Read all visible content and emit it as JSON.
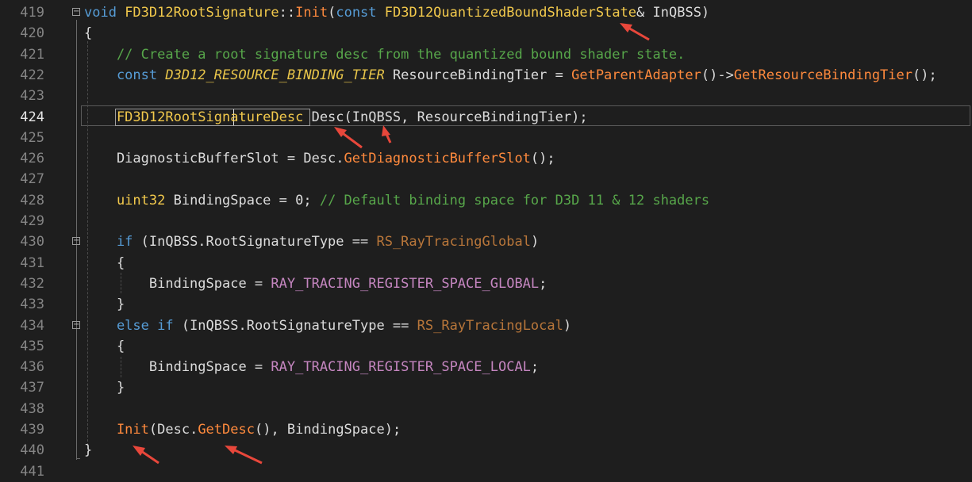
{
  "editor": {
    "active_line": "424",
    "lines": [
      {
        "number": "419",
        "tokens": [
          {
            "t": "void",
            "c": "kw"
          },
          {
            "t": " FD3D12RootSignature",
            "c": "cls"
          },
          {
            "t": "::",
            "c": "pl"
          },
          {
            "t": "Init",
            "c": "fn"
          },
          {
            "t": "(",
            "c": "pl"
          },
          {
            "t": "const",
            "c": "kw"
          },
          {
            "t": " FD3D12QuantizedBoundShaderState",
            "c": "cls"
          },
          {
            "t": "& InQBSS)",
            "c": "pl"
          }
        ]
      },
      {
        "number": "420",
        "tokens": [
          {
            "t": "{",
            "c": "pl"
          }
        ]
      },
      {
        "number": "421",
        "tokens": [
          {
            "t": "    // Create a root signature desc from the quantized bound shader state.",
            "c": "cm"
          }
        ]
      },
      {
        "number": "422",
        "tokens": [
          {
            "t": "    const ",
            "c": "kw"
          },
          {
            "t": "D3D12_RESOURCE_BINDING_TIER",
            "c": "ital"
          },
          {
            "t": " ResourceBindingTier = ",
            "c": "pl"
          },
          {
            "t": "GetParentAdapter",
            "c": "fn"
          },
          {
            "t": "()->",
            "c": "pl"
          },
          {
            "t": "GetResourceBindingTier",
            "c": "fn"
          },
          {
            "t": "();",
            "c": "pl"
          }
        ]
      },
      {
        "number": "423",
        "tokens": []
      },
      {
        "number": "424",
        "tokens": [
          {
            "t": "    FD3D12RootSignatureDesc",
            "c": "cls"
          },
          {
            "t": " Desc(InQBSS, ResourceBindingTier);",
            "c": "pl"
          }
        ]
      },
      {
        "number": "425",
        "tokens": []
      },
      {
        "number": "426",
        "tokens": [
          {
            "t": "    DiagnosticBufferSlot = Desc.",
            "c": "pl"
          },
          {
            "t": "GetDiagnosticBufferSlot",
            "c": "fn"
          },
          {
            "t": "();",
            "c": "pl"
          }
        ]
      },
      {
        "number": "427",
        "tokens": []
      },
      {
        "number": "428",
        "tokens": [
          {
            "t": "    uint32",
            "c": "cls"
          },
          {
            "t": " BindingSpace = 0; ",
            "c": "pl"
          },
          {
            "t": "// Default binding space for D3D 11 & 12 shaders",
            "c": "cm"
          }
        ]
      },
      {
        "number": "429",
        "tokens": []
      },
      {
        "number": "430",
        "tokens": [
          {
            "t": "    if",
            "c": "kw"
          },
          {
            "t": " (InQBSS.RootSignatureType == ",
            "c": "pl"
          },
          {
            "t": "RS_RayTracingGlobal",
            "c": "enm"
          },
          {
            "t": ")",
            "c": "pl"
          }
        ]
      },
      {
        "number": "431",
        "tokens": [
          {
            "t": "    {",
            "c": "pl"
          }
        ]
      },
      {
        "number": "432",
        "tokens": [
          {
            "t": "        BindingSpace = ",
            "c": "pl"
          },
          {
            "t": "RAY_TRACING_REGISTER_SPACE_GLOBAL",
            "c": "mac"
          },
          {
            "t": ";",
            "c": "pl"
          }
        ]
      },
      {
        "number": "433",
        "tokens": [
          {
            "t": "    }",
            "c": "pl"
          }
        ]
      },
      {
        "number": "434",
        "tokens": [
          {
            "t": "    else if",
            "c": "kw"
          },
          {
            "t": " (InQBSS.RootSignatureType == ",
            "c": "pl"
          },
          {
            "t": "RS_RayTracingLocal",
            "c": "enm"
          },
          {
            "t": ")",
            "c": "pl"
          }
        ]
      },
      {
        "number": "435",
        "tokens": [
          {
            "t": "    {",
            "c": "pl"
          }
        ]
      },
      {
        "number": "436",
        "tokens": [
          {
            "t": "        BindingSpace = ",
            "c": "pl"
          },
          {
            "t": "RAY_TRACING_REGISTER_SPACE_LOCAL",
            "c": "mac"
          },
          {
            "t": ";",
            "c": "pl"
          }
        ]
      },
      {
        "number": "437",
        "tokens": [
          {
            "t": "    }",
            "c": "pl"
          }
        ]
      },
      {
        "number": "438",
        "tokens": []
      },
      {
        "number": "439",
        "tokens": [
          {
            "t": "    Init",
            "c": "fn"
          },
          {
            "t": "(Desc.",
            "c": "pl"
          },
          {
            "t": "GetDesc",
            "c": "fn"
          },
          {
            "t": "(), BindingSpace);",
            "c": "pl"
          }
        ]
      },
      {
        "number": "440",
        "tokens": [
          {
            "t": "}",
            "c": "pl"
          }
        ]
      },
      {
        "number": "441",
        "tokens": []
      }
    ],
    "fold_markers": [
      "419",
      "430",
      "434"
    ],
    "annotation_arrow_color": "#e8473b"
  }
}
